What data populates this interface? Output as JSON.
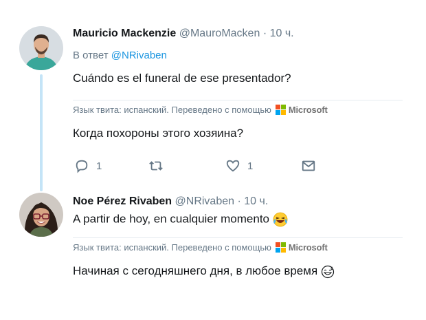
{
  "tweet1": {
    "name": "Mauricio Mackenzie",
    "handle": "@MauroMacken",
    "sep": "·",
    "time": "10 ч.",
    "reply_prefix": "В ответ",
    "reply_to": "@NRivaben",
    "text": "Cuándo es el funeral de ese presentador?",
    "translation_note": "Язык твита: испанский. Переведено с помощью",
    "translator": "Microsoft",
    "translated_text": "Когда похороны этого хозяина?",
    "actions": {
      "reply_count": "1",
      "retweet_count": "",
      "like_count": "1"
    },
    "icons": [
      "reply-icon",
      "retweet-icon",
      "like-icon",
      "message-icon"
    ]
  },
  "tweet2": {
    "name": "Noe Pérez Rivaben",
    "handle": "@NRivaben",
    "sep": "·",
    "time": "10 ч.",
    "text": "A partir de hoy, en cualquier momento",
    "emoji": "laughing-crying-emoji",
    "translation_note": "Язык твита: испанский. Переведено с помощью",
    "translator": "Microsoft",
    "translated_text": "Начиная с сегодняшнего дня, в любое время",
    "translated_emoji": "grinning-sweat-emoji"
  },
  "colors": {
    "link": "#1b95e0",
    "muted": "#657786",
    "thread_line": "#c4e4f7",
    "ms_red": "#f25022",
    "ms_green": "#7fba00",
    "ms_blue": "#00a4ef",
    "ms_yellow": "#ffb900"
  }
}
